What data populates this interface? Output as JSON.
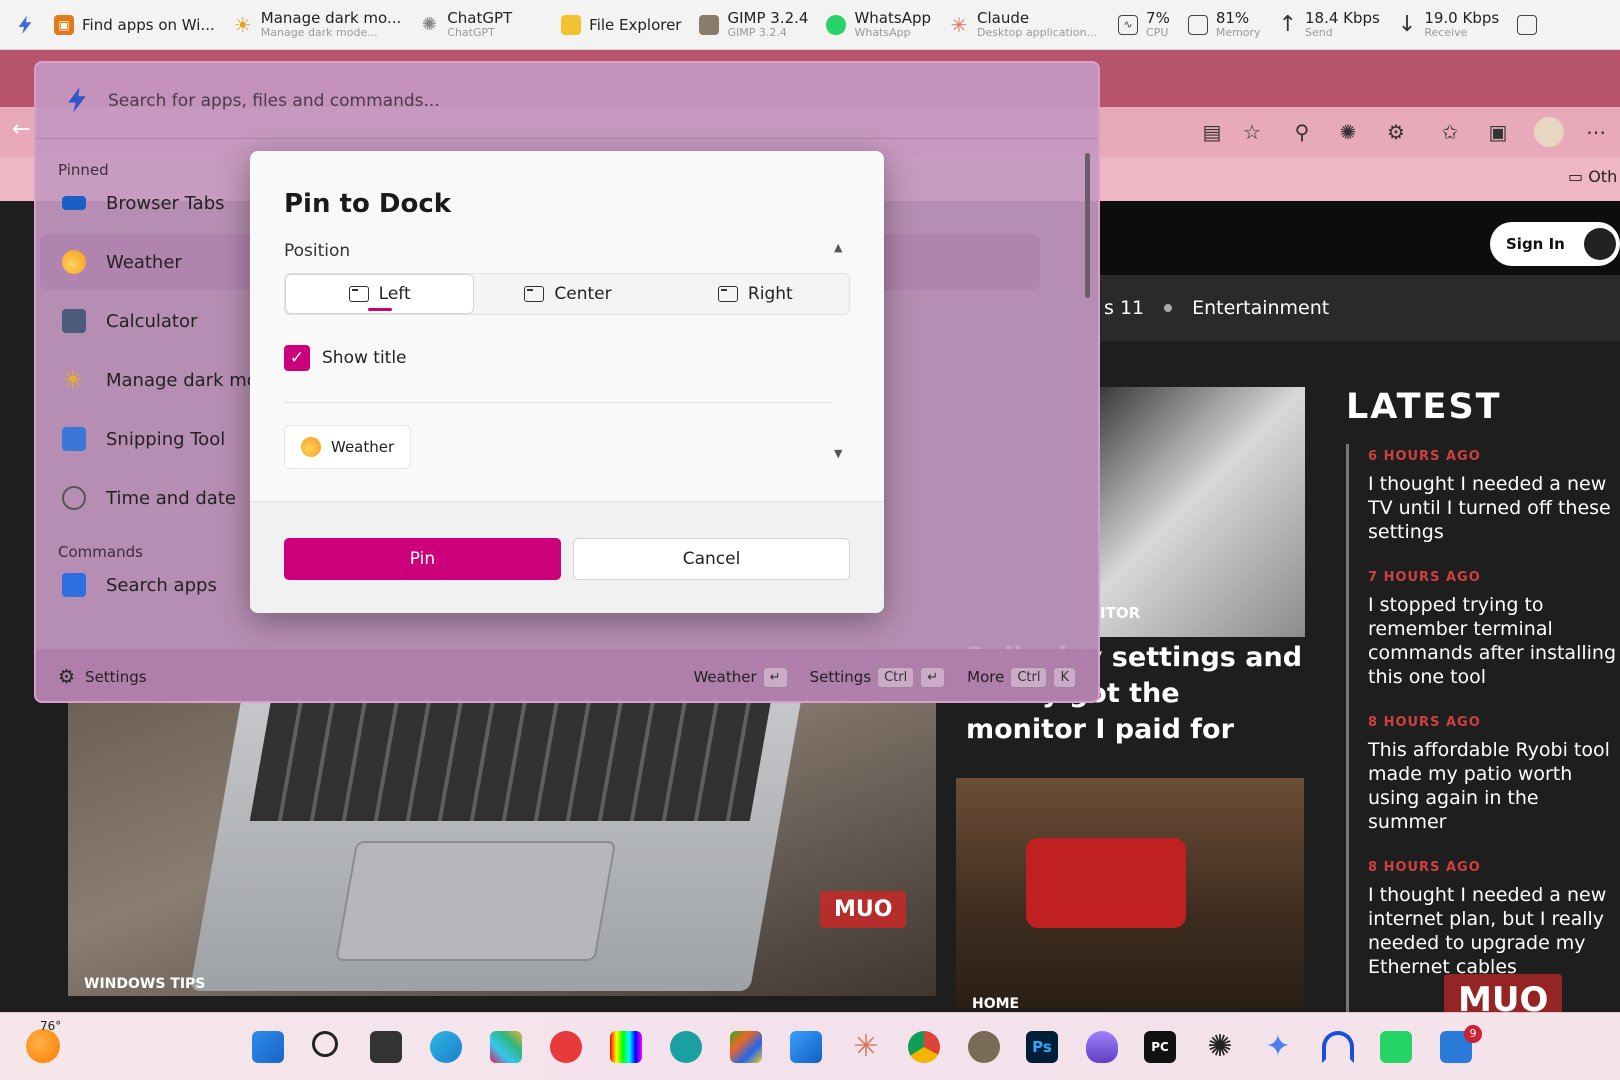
{
  "topbar": {
    "items": [
      {
        "title": "Find apps on Wi...",
        "sub": ""
      },
      {
        "title": "Manage dark mo...",
        "sub": "Manage dark mode..."
      },
      {
        "title": "ChatGPT",
        "sub": "ChatGPT"
      },
      {
        "title": "File Explorer",
        "sub": ""
      },
      {
        "title": "GIMP 3.2.4",
        "sub": "GIMP 3.2.4"
      },
      {
        "title": "WhatsApp",
        "sub": "WhatsApp"
      },
      {
        "title": "Claude",
        "sub": "Desktop application..."
      }
    ],
    "stats": [
      {
        "title": "7%",
        "sub": "CPU"
      },
      {
        "title": "81%",
        "sub": "Memory"
      },
      {
        "title": "18.4 Kbps",
        "sub": "Send"
      },
      {
        "title": "19.0 Kbps",
        "sub": "Receive"
      }
    ]
  },
  "browser": {
    "bookmark_other": "Oth",
    "signin": "Sign In Now",
    "nav": [
      "s 11",
      "Entertainment"
    ],
    "monitor_label": "ITOR",
    "headline_big": "3 display settings and finally got the monitor I paid for",
    "tag_windows_tips": "WINDOWS TIPS",
    "tag_home": "HOME",
    "muo": "MUO",
    "latest": {
      "title": "LATEST",
      "items": [
        {
          "time": "6 HOURS AGO",
          "headline": "I thought I needed a new TV until I turned off these settings"
        },
        {
          "time": "7 HOURS AGO",
          "headline": "I stopped trying to remember terminal commands after installing this one tool"
        },
        {
          "time": "8 HOURS AGO",
          "headline": "This affordable Ryobi tool made my patio worth using again in the summer"
        },
        {
          "time": "8 HOURS AGO",
          "headline": "I thought I needed a new internet plan, but I really needed to upgrade my Ethernet cables"
        }
      ]
    }
  },
  "launcher": {
    "search_placeholder": "Search for apps, files and commands...",
    "pinned_header": "Pinned",
    "commands_header": "Commands",
    "pinned": [
      {
        "label": "Browser Tabs",
        "color": "#1a5fc8"
      },
      {
        "label": "Weather",
        "color": "#f5a623"
      },
      {
        "label": "Calculator",
        "color": "#4a5a7a"
      },
      {
        "label": "Manage dark mo",
        "color": "#e8c020"
      },
      {
        "label": "Snipping Tool",
        "color": "#3a78d8"
      },
      {
        "label": "Time and date",
        "color": "#6a6a6a"
      }
    ],
    "commands": [
      {
        "label": "Search apps",
        "color": "#2f6ee0"
      }
    ],
    "footer": {
      "settings": "Settings",
      "hint1_label": "Weather",
      "hint1_key": "↵",
      "hint2_label": "Settings",
      "hint2_keys": [
        "Ctrl",
        "↵"
      ],
      "hint3_label": "More",
      "hint3_keys": [
        "Ctrl",
        "K"
      ]
    }
  },
  "modal": {
    "title": "Pin to Dock",
    "position_label": "Position",
    "positions": [
      "Left",
      "Center",
      "Right"
    ],
    "selected_position": "Left",
    "show_title_label": "Show title",
    "show_title_checked": true,
    "preview_label": "Weather",
    "pin_label": "Pin",
    "cancel_label": "Cancel",
    "accent": "#cc007a"
  },
  "taskbar": {
    "weather_temp": "76°",
    "badge": "9"
  }
}
